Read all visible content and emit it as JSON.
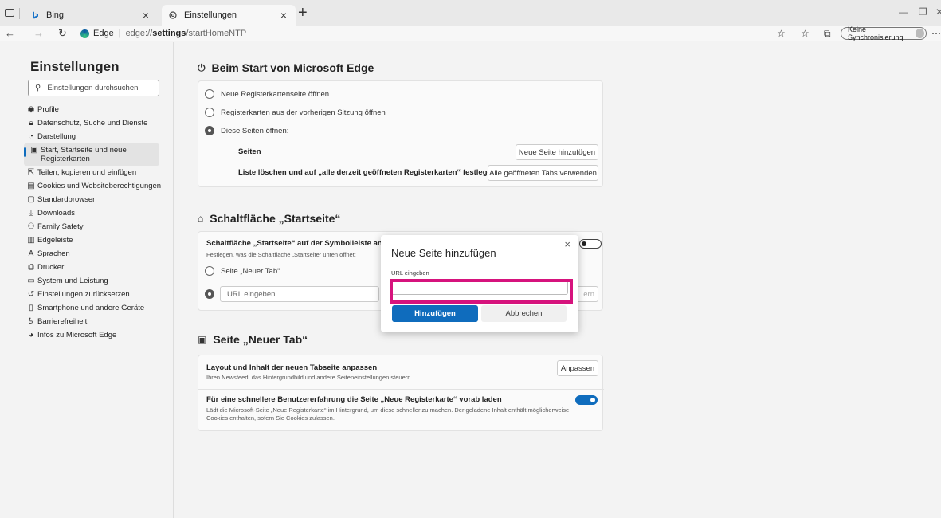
{
  "tabs": [
    {
      "title": "Bing",
      "icon": "bing-icon"
    },
    {
      "title": "Einstellungen",
      "icon": "gear-icon"
    }
  ],
  "address": {
    "site": "Edge",
    "url_prefix": "edge://",
    "url_bold": "settings",
    "url_suffix": "/startHomeNTP"
  },
  "sync_label": "Keine Synchronisierung",
  "sidebar": {
    "title": "Einstellungen",
    "search_placeholder": "Einstellungen durchsuchen",
    "items": [
      {
        "label": "Profile",
        "icon": "profile-icon"
      },
      {
        "label": "Datenschutz, Suche und Dienste",
        "icon": "lock-icon"
      },
      {
        "label": "Darstellung",
        "icon": "appearance-icon"
      },
      {
        "label": "Start, Startseite und neue Registerkarten",
        "icon": "start-icon"
      },
      {
        "label": "Teilen, kopieren und einfügen",
        "icon": "share-icon"
      },
      {
        "label": "Cookies und Websiteberechtigungen",
        "icon": "cookies-icon"
      },
      {
        "label": "Standardbrowser",
        "icon": "browser-icon"
      },
      {
        "label": "Downloads",
        "icon": "download-icon"
      },
      {
        "label": "Family Safety",
        "icon": "family-icon"
      },
      {
        "label": "Edgeleiste",
        "icon": "edgebar-icon"
      },
      {
        "label": "Sprachen",
        "icon": "language-icon"
      },
      {
        "label": "Drucker",
        "icon": "printer-icon"
      },
      {
        "label": "System und Leistung",
        "icon": "system-icon"
      },
      {
        "label": "Einstellungen zurücksetzen",
        "icon": "reset-icon"
      },
      {
        "label": "Smartphone und andere Geräte",
        "icon": "phone-icon"
      },
      {
        "label": "Barrierefreiheit",
        "icon": "accessibility-icon"
      },
      {
        "label": "Infos zu Microsoft Edge",
        "icon": "edge-icon"
      }
    ]
  },
  "startup": {
    "title": "Beim Start von Microsoft Edge",
    "opt1": "Neue Registerkartenseite öffnen",
    "opt2": "Registerkarten aus der vorherigen Sitzung öffnen",
    "opt3": "Diese Seiten öffnen:",
    "pages_label": "Seiten",
    "add_page_btn": "Neue Seite hinzufügen",
    "clear_label": "Liste löschen und auf „alle derzeit geöffneten Registerkarten“ festlegen",
    "use_tabs_btn": "Alle geöffneten Tabs verwenden"
  },
  "home": {
    "title": "Schaltfläche „Startseite“",
    "toggle_label": "Schaltfläche „Startseite“ auf der Symbolleiste anzeigen",
    "toggle_desc": "Festlegen, was die Schaltfläche „Startseite“ unten öffnet:",
    "opt_newtab": "Seite „Neuer Tab“",
    "url_placeholder": "URL eingeben",
    "save_partial": "ern"
  },
  "newtab": {
    "title": "Seite „Neuer Tab“",
    "layout_label": "Layout und Inhalt der neuen Tabseite anpassen",
    "layout_desc": "Ihren Newsfeed, das Hintergrundbild und andere Seiteneinstellungen steuern",
    "customize_btn": "Anpassen",
    "preload_label": "Für eine schnellere Benutzererfahrung die Seite „Neue Registerkarte“ vorab laden",
    "preload_desc1": "Lädt die Microsoft-Seite „Neue Registerkarte“ im Hintergrund, um diese schneller zu machen. Der geladene Inhalt enthält möglicherweise",
    "preload_desc2": "Cookies enthalten, sofern Sie Cookies zulassen."
  },
  "dialog": {
    "title": "Neue Seite hinzufügen",
    "url_label": "URL eingeben",
    "url_value": "",
    "add_btn": "Hinzufügen",
    "cancel_btn": "Abbrechen"
  },
  "colors": {
    "accent": "#0f6cbd",
    "highlight": "#d6137d"
  }
}
